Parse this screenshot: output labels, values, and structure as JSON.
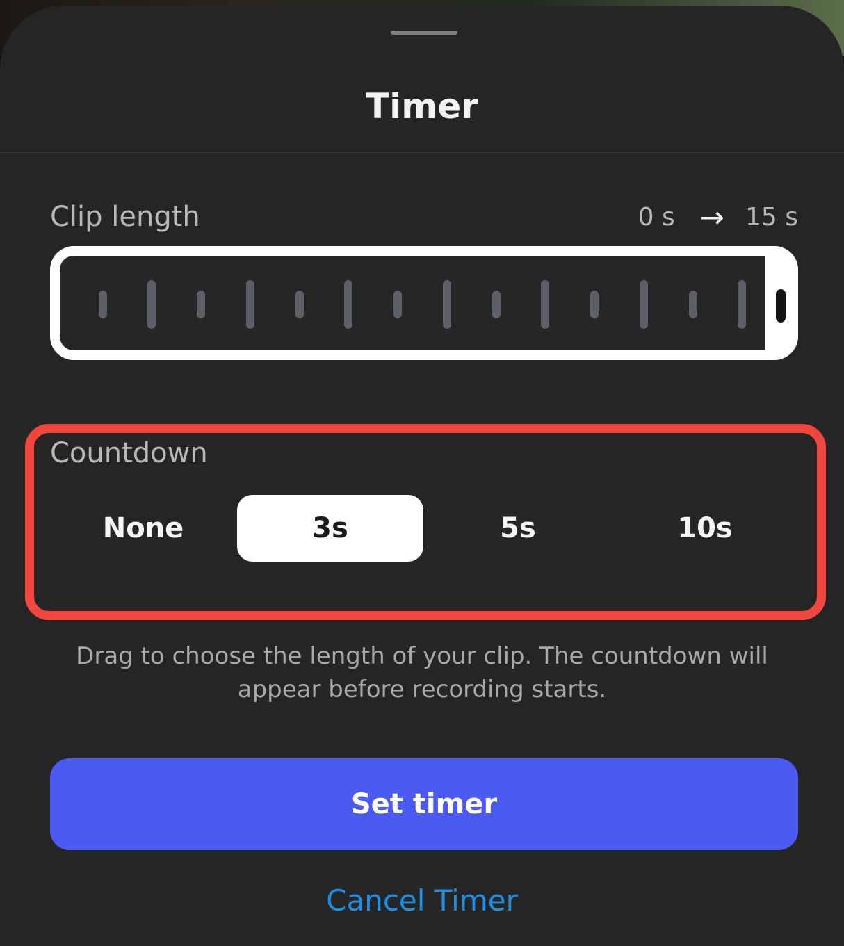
{
  "sheet": {
    "title": "Timer"
  },
  "clip_length": {
    "label": "Clip length",
    "range_start": "0 s",
    "range_end": "15 s",
    "arrow_icon": "arrow-right-icon"
  },
  "countdown": {
    "label": "Countdown",
    "options": [
      "None",
      "3s",
      "5s",
      "10s"
    ],
    "selected": "3s"
  },
  "hint": "Drag to choose the length of your clip. The countdown will appear before recording starts.",
  "actions": {
    "set_timer": "Set timer",
    "cancel_timer": "Cancel Timer"
  },
  "colors": {
    "primary": "#4b5af0",
    "link": "#1e8fe6",
    "highlight": "#f0463e",
    "sheet_bg": "#252525"
  }
}
